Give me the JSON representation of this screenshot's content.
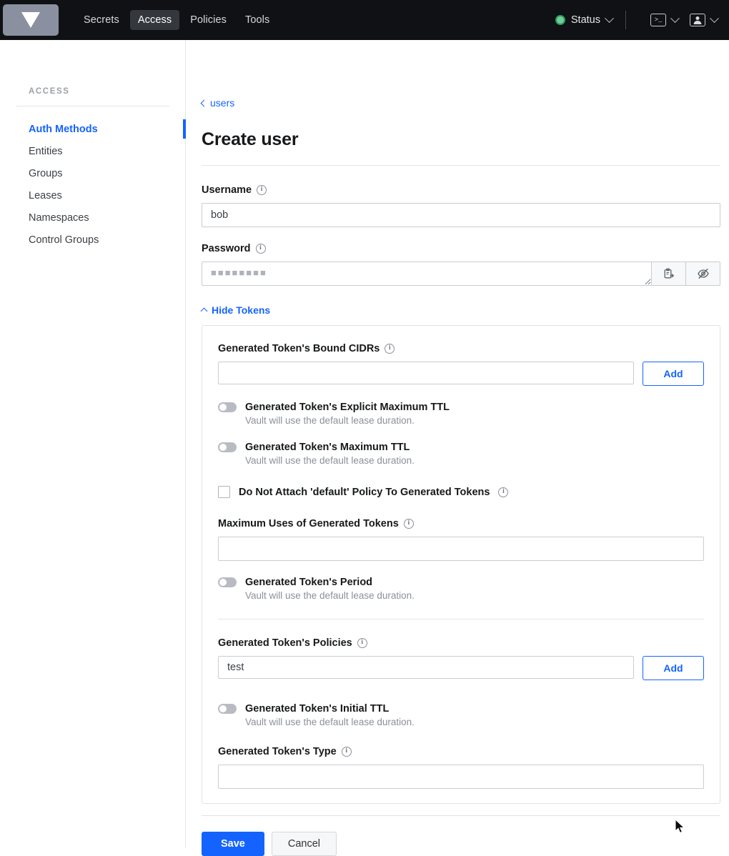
{
  "navbar": {
    "logo_name": "vault-logo",
    "links": [
      {
        "label": "Secrets",
        "active": false
      },
      {
        "label": "Access",
        "active": true
      },
      {
        "label": "Policies",
        "active": false
      },
      {
        "label": "Tools",
        "active": false
      }
    ],
    "status": {
      "label": "Status",
      "dot_color": "#1fa35a"
    },
    "console_icon_glyph": ">_",
    "accent": "#1563ff",
    "background": "#0f1114"
  },
  "sidebar": {
    "title": "ACCESS",
    "items": [
      {
        "label": "Auth Methods",
        "active": true
      },
      {
        "label": "Entities",
        "active": false
      },
      {
        "label": "Groups",
        "active": false
      },
      {
        "label": "Leases",
        "active": false
      },
      {
        "label": "Namespaces",
        "active": false
      },
      {
        "label": "Control Groups",
        "active": false
      }
    ]
  },
  "breadcrumb": {
    "label": "users"
  },
  "page": {
    "title": "Create user"
  },
  "username": {
    "label": "Username",
    "value": "bob",
    "placeholder": ""
  },
  "password": {
    "label": "Password",
    "value": "■■■■■■■■",
    "placeholder": "",
    "copy_icon": "clipboard-copy-icon",
    "visibility_icon": "eye-off-icon"
  },
  "tokens_toggle": {
    "label": "Hide Tokens",
    "expanded": true
  },
  "token_card": {
    "bound_cidrs": {
      "label": "Generated Token's Bound CIDRs",
      "value": "",
      "placeholder": "",
      "add_label": "Add"
    },
    "explicit_max_ttl": {
      "label": "Generated Token's Explicit Maximum TTL",
      "help": "Vault will use the default lease duration.",
      "enabled": false
    },
    "max_ttl": {
      "label": "Generated Token's Maximum TTL",
      "help": "Vault will use the default lease duration.",
      "enabled": false
    },
    "no_default_policy": {
      "label": "Do Not Attach 'default' Policy To Generated Tokens",
      "checked": false
    },
    "max_uses": {
      "label": "Maximum Uses of Generated Tokens",
      "value": "",
      "placeholder": ""
    },
    "period": {
      "label": "Generated Token's Period",
      "help": "Vault will use the default lease duration.",
      "enabled": false
    },
    "policies": {
      "label": "Generated Token's Policies",
      "value": "test",
      "placeholder": "",
      "add_label": "Add"
    },
    "initial_ttl": {
      "label": "Generated Token's Initial TTL",
      "help": "Vault will use the default lease duration.",
      "enabled": false
    },
    "token_type": {
      "label": "Generated Token's Type",
      "value": "",
      "placeholder": ""
    }
  },
  "footer": {
    "save_label": "Save",
    "cancel_label": "Cancel"
  }
}
